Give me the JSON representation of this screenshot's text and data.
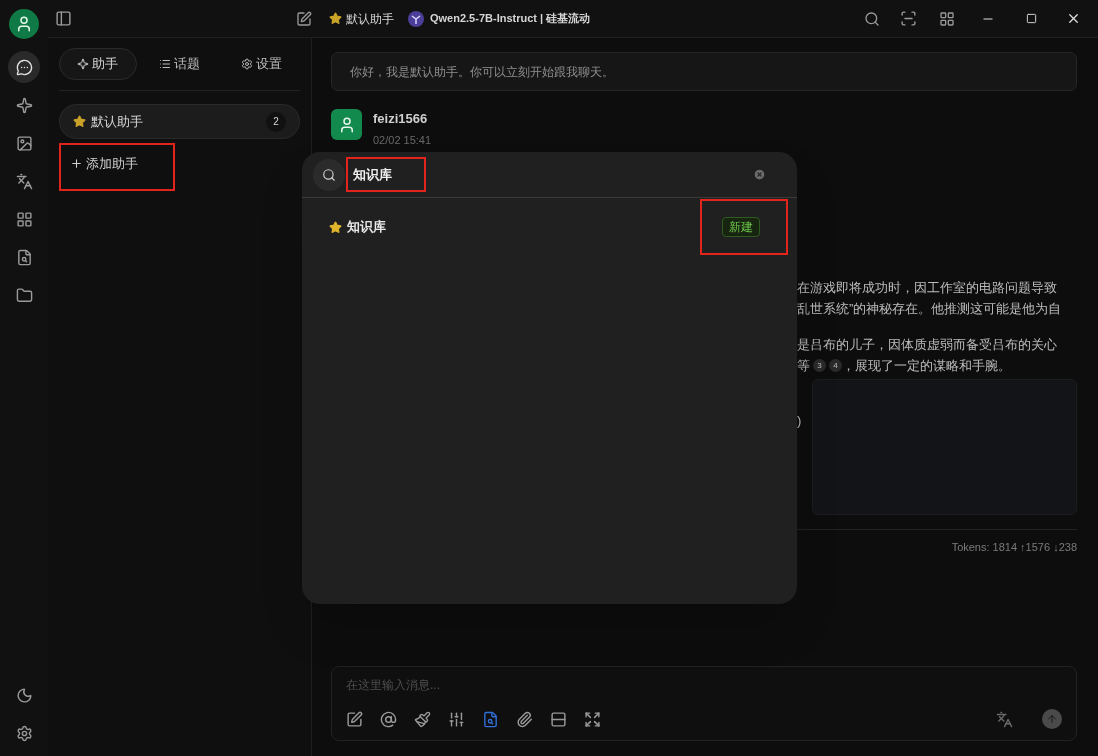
{
  "window": {
    "assistant": "默认助手",
    "model": "Qwen2.5-7B-Instruct | 硅基流动"
  },
  "rail": [
    {
      "kind": "chat",
      "selected": true
    },
    {
      "kind": "sparkle",
      "selected": false
    },
    {
      "kind": "image",
      "selected": false
    },
    {
      "kind": "translate",
      "selected": false
    },
    {
      "kind": "apps",
      "selected": false
    },
    {
      "kind": "knowledge",
      "selected": false
    },
    {
      "kind": "files",
      "selected": false
    }
  ],
  "sidebar": {
    "tabs": [
      {
        "label": "助手",
        "selected": true
      },
      {
        "label": "话题",
        "selected": false
      },
      {
        "label": "设置",
        "selected": false
      }
    ],
    "assistants": [
      {
        "name": "默认助手",
        "count": "2",
        "selected": true
      }
    ],
    "add": {
      "label": "添加助手",
      "highlighted": true
    }
  },
  "chat": {
    "greeting": "你好，我是默认助手。你可以立刻开始跟我聊天。",
    "message": {
      "user": "feizi1566",
      "time": "02/02 15:41",
      "paragraphs": [
        [
          {
            "text": "在游戏即将成功时，因工作室的电路问题导致"
          },
          {
            "text": "乱世系统”的神秘存在。他推测这可能是他为自"
          }
        ],
        [
          {
            "text": "是吕布的儿子，因体质虚弱而备受吕布的关心"
          },
          {
            "text": "等",
            "citations": [
              "3",
              "4"
            ],
            "after": "，展现了一定的谋略和手腕。"
          }
        ]
      ],
      "code": ")"
    },
    "tokens": "Tokens: 1814 ↑1576 ↓238",
    "input": {
      "placeholder": "在这里输入消息...",
      "tools": [
        {
          "kind": "edit",
          "selected": false
        },
        {
          "kind": "mention",
          "selected": false
        },
        {
          "kind": "clear",
          "selected": false
        },
        {
          "kind": "sliders",
          "selected": false
        },
        {
          "kind": "knowledge",
          "selected": true
        },
        {
          "kind": "attach",
          "selected": false
        },
        {
          "kind": "divider",
          "selected": false
        },
        {
          "kind": "expand",
          "selected": false
        }
      ]
    }
  },
  "modal": {
    "search": {
      "value": "知识库",
      "highlighted": true
    },
    "results": [
      {
        "name": "知识库",
        "action": "新建",
        "highlighted": true
      }
    ]
  }
}
